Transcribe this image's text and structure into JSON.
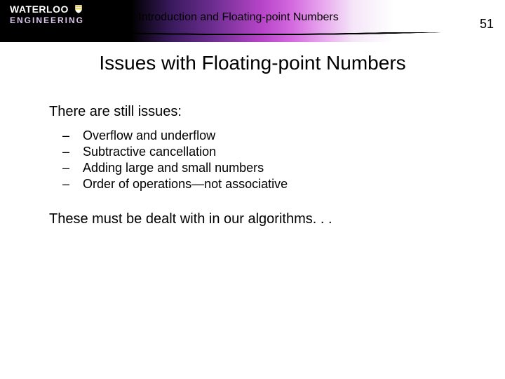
{
  "header": {
    "logo_top": "WATERLOO",
    "logo_bottom": "ENGINEERING",
    "subtitle": "Introduction and Floating-point Numbers",
    "page_number": "51"
  },
  "title": "Issues with Floating-point Numbers",
  "body": {
    "intro": "There are still issues:",
    "bullets": [
      "Overflow and underflow",
      "Subtractive cancellation",
      "Adding large and small numbers",
      "Order of operations—not associative"
    ],
    "outro": "These must be dealt with in our algorithms. . ."
  }
}
